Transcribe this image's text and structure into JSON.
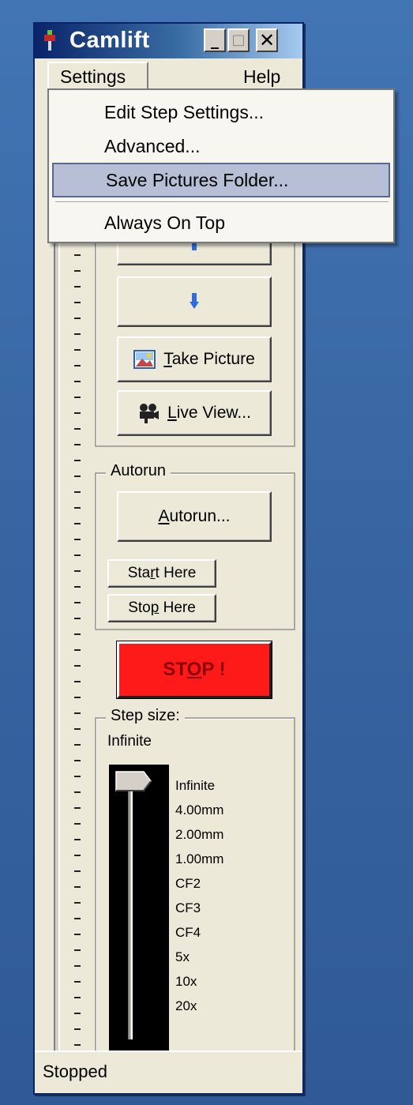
{
  "window": {
    "title": "Camlift",
    "buttons": {
      "minimize": "_",
      "maximize": "□",
      "close": "✕"
    }
  },
  "menubar": {
    "settings": "Settings",
    "help": "Help"
  },
  "settings_menu": {
    "items": [
      "Edit Step Settings...",
      "Advanced...",
      "Save Pictures Folder...",
      "Always On Top"
    ],
    "selected_index": 2
  },
  "controls": {
    "take_picture": {
      "underlined": "T",
      "rest": "ake Picture"
    },
    "live_view": {
      "underlined": "L",
      "rest": "ive View..."
    }
  },
  "autorun": {
    "group_label": "Autorun",
    "autorun_button": {
      "underlined": "A",
      "rest": "utorun..."
    },
    "start_here": {
      "pre": "Sta",
      "underlined": "r",
      "post": "t Here"
    },
    "stop_here": {
      "pre": "Sto",
      "underlined": "p",
      "post": " Here"
    }
  },
  "stop_button": {
    "pre": "ST",
    "underlined": "O",
    "post": "P !"
  },
  "step_size": {
    "group_label": "Step size:",
    "current_value": "Infinite",
    "options": [
      "Infinite",
      "4.00mm",
      "2.00mm",
      "1.00mm",
      "CF2",
      "CF3",
      "CF4",
      "5x",
      "10x",
      "20x"
    ],
    "selected_index": 0
  },
  "statusbar": {
    "text": "Stopped"
  },
  "colors": {
    "desktop": "#3a6aa5",
    "titlebar_start": "#0a246a",
    "window_face": "#ece9d8",
    "stop_red": "#ff1a1a",
    "menu_highlight": "#b6bfd6"
  }
}
